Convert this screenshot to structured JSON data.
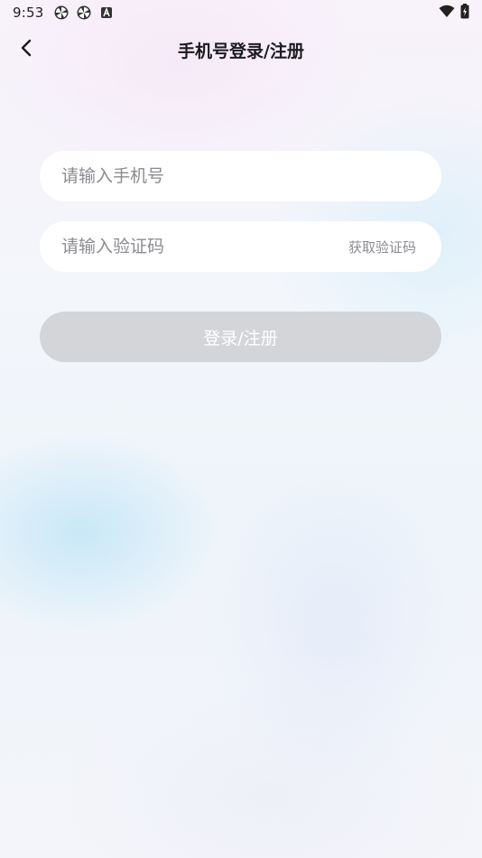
{
  "status_bar": {
    "time": "9:53",
    "left_icons": [
      "pinwheel-icon",
      "pinwheel-icon",
      "a-badge-icon"
    ],
    "right_icons": [
      "wifi-icon",
      "battery-charging-icon"
    ]
  },
  "nav": {
    "back_icon": "chevron-left-icon",
    "title": "手机号登录/注册"
  },
  "form": {
    "phone": {
      "value": "",
      "placeholder": "请输入手机号"
    },
    "code": {
      "value": "",
      "placeholder": "请输入验证码",
      "get_code_label": "获取验证码"
    },
    "submit_label": "登录/注册"
  },
  "colors": {
    "button_disabled": "#d3d5d9",
    "input_bg": "#ffffff",
    "placeholder": "#8b8b91",
    "title": "#1b1b1f"
  }
}
